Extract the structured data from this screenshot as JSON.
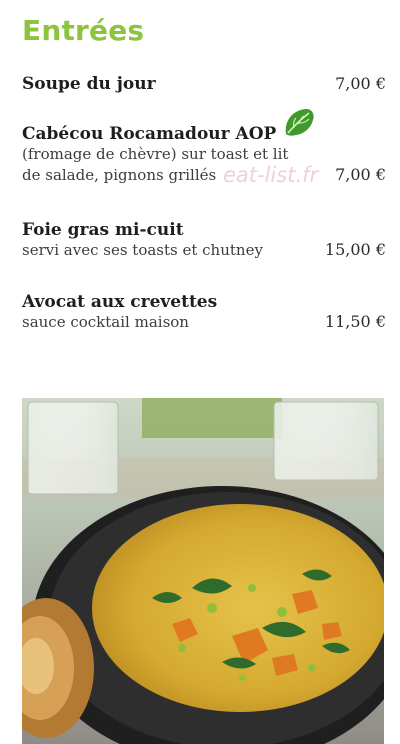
{
  "section": {
    "title": "Entrées"
  },
  "items": [
    {
      "name": "Soupe du jour",
      "description": [],
      "price": "7,00 €"
    },
    {
      "name": "Cabécou Rocamadour AOP",
      "description": [
        "(fromage de chèvre) sur toast et lit",
        "de salade, pignons grillés"
      ],
      "price": "7,00 €"
    },
    {
      "name": "Foie gras mi-cuit",
      "description": [
        "servi avec ses toasts et chutney"
      ],
      "price": "15,00 €"
    },
    {
      "name": "Avocat aux crevettes",
      "description": [
        "sauce cocktail maison"
      ],
      "price": "11,50 €"
    }
  ],
  "watermark": "eat-list.fr",
  "icons": {
    "vegetarian": "green-leaf-icon"
  },
  "colors": {
    "accent": "#8cc43f",
    "leaf": "#3f9a2a"
  },
  "photo": {
    "subject": "soup-bowl-photo"
  }
}
